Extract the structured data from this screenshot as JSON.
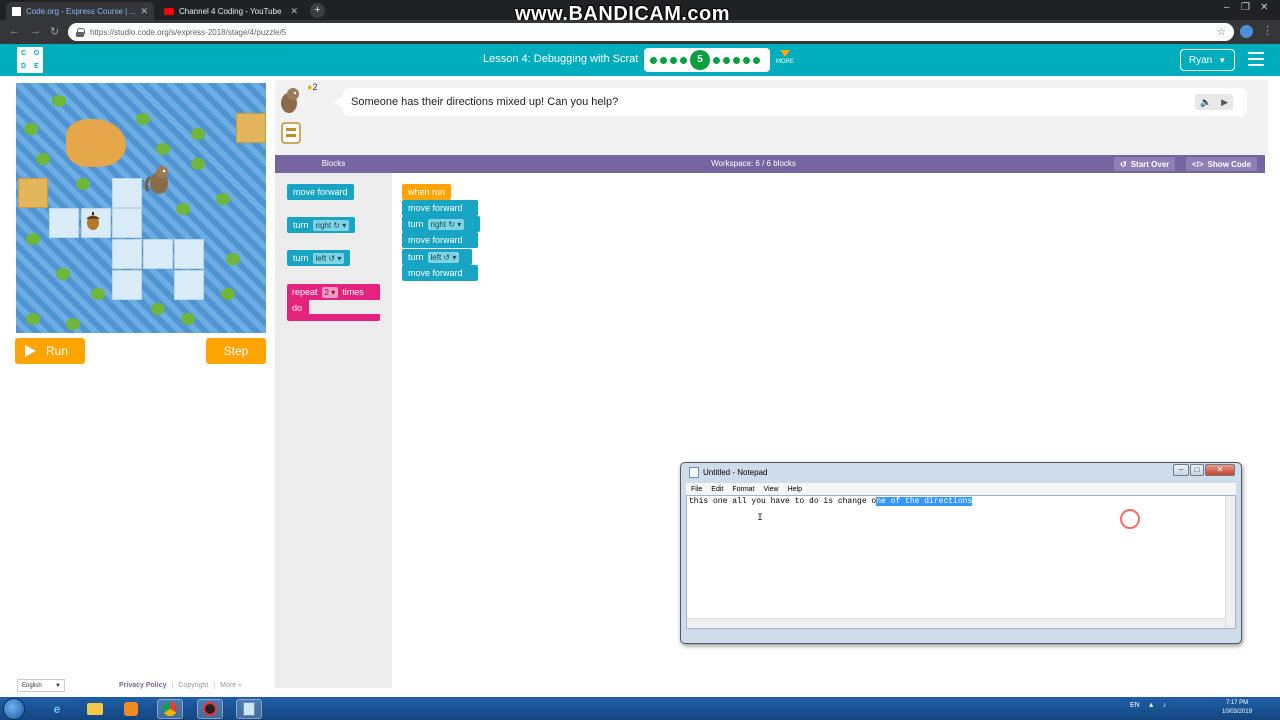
{
  "browser": {
    "tabs": [
      {
        "title": "Code.org - Express Course | ...",
        "active": true
      },
      {
        "title": "Channel 4 Coding - YouTube",
        "active": false
      }
    ],
    "url": "https://studio.code.org/s/express-2018/stage/4/puzzle/5",
    "watermark": "www.BANDICAM.com"
  },
  "header": {
    "logo_letters": [
      "C",
      "O",
      "D",
      "E"
    ],
    "lesson_title": "Lesson 4: Debugging with Scrat",
    "current_puzzle": "5",
    "more_label": "MORE",
    "user_name": "Ryan"
  },
  "game": {
    "run_label": "Run",
    "step_label": "Step"
  },
  "instructions": {
    "hint_count": "2",
    "text": "Someone has their directions mixed up! Can you help?"
  },
  "workspace_bar": {
    "blocks_label": "Blocks",
    "workspace_label": "Workspace: 6 / 6 blocks",
    "start_over_label": "Start Over",
    "show_code_label": "Show Code"
  },
  "toolbox": {
    "move_forward": "move forward",
    "turn_word": "turn",
    "right": "right ↻",
    "left": "left ↺",
    "repeat_word": "repeat",
    "repeat_count": "2",
    "times_word": "times",
    "do_word": "do"
  },
  "program": {
    "when_run": "when run",
    "blocks": [
      {
        "kind": "move",
        "label": "move forward"
      },
      {
        "kind": "turn",
        "label": "turn",
        "dir": "right ↻"
      },
      {
        "kind": "move",
        "label": "move forward"
      },
      {
        "kind": "turn",
        "label": "turn",
        "dir": "left ↺"
      },
      {
        "kind": "move",
        "label": "move forward"
      }
    ]
  },
  "footer": {
    "language": "English",
    "privacy": "Privacy Policy",
    "copyright": "Copyright",
    "more": "More »"
  },
  "notepad": {
    "title": "Untitled - Notepad",
    "menu": [
      "File",
      "Edit",
      "Format",
      "View",
      "Help"
    ],
    "text_plain": "this one all you have to do is change o",
    "text_selected": "ne of the directions"
  },
  "taskbar": {
    "lang": "EN",
    "time": "7:17 PM",
    "date": "10/03/2019"
  },
  "colors": {
    "codeorg_teal": "#00adbc",
    "workspace_purple": "#7665a0",
    "block_blue": "#18a5c4",
    "event_orange": "#ffa400",
    "loop_pink": "#e6227f"
  }
}
